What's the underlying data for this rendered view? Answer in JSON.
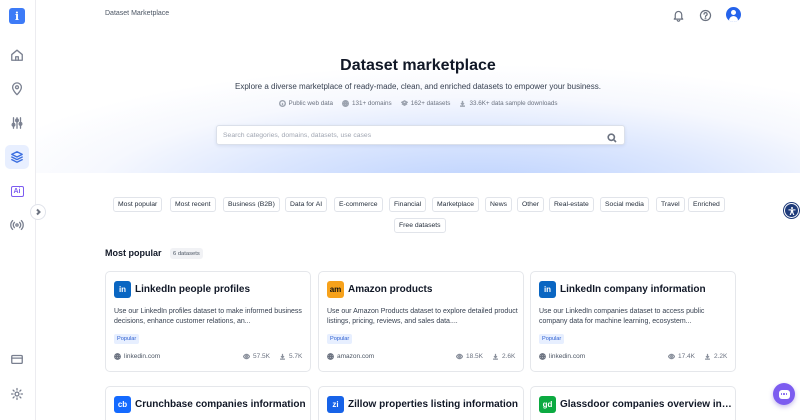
{
  "header": {
    "breadcrumb": "Dataset Marketplace",
    "icons": [
      "bell-icon",
      "help-icon",
      "user-avatar-icon"
    ]
  },
  "sidebar": {
    "logo": "i",
    "ai_label": "Ai",
    "items": [
      "home-icon",
      "location-pin-icon",
      "sliders-icon",
      "layers-icon",
      "ai-icon",
      "radar-icon",
      "billing-card-icon",
      "settings-gear-icon"
    ]
  },
  "hero": {
    "title": "Dataset marketplace",
    "subtitle": "Explore a diverse marketplace of ready-made, clean, and enriched datasets to empower your business.",
    "stats": [
      {
        "icon": "info-icon",
        "text": "Public web data"
      },
      {
        "icon": "globe-icon",
        "text": "131+ domains"
      },
      {
        "icon": "layers-icon",
        "text": "162+ datasets"
      },
      {
        "icon": "download-icon",
        "text": "33.6K+ data sample downloads"
      }
    ]
  },
  "search": {
    "placeholder": "Search categories, domains, datasets, use cases",
    "value": ""
  },
  "filters": [
    "Most popular",
    "Most recent",
    "Business (B2B)",
    "Data for AI",
    "E-commerce",
    "Financial",
    "Marketplace",
    "News",
    "Other",
    "Real-estate",
    "Social media",
    "Travel",
    "Enriched",
    "Free datasets"
  ],
  "section": {
    "title": "Most popular",
    "count": "6 datasets"
  },
  "cards": [
    {
      "logo": "in",
      "logo_color": "#0a66c2",
      "title": "LinkedIn people profiles",
      "desc": "Use our LinkedIn profiles dataset to make informed business decisions, enhance customer relations, an...",
      "tag": "Popular",
      "domain": "linkedin.com",
      "views": "57.5K",
      "downloads": "5.7K"
    },
    {
      "logo": "am",
      "logo_color": "#f7a21b",
      "title": "Amazon products",
      "desc": "Use our Amazon Products dataset to explore detailed product listings, pricing, reviews, and sales data....",
      "tag": "Popular",
      "domain": "amazon.com",
      "views": "18.5K",
      "downloads": "2.6K"
    },
    {
      "logo": "in",
      "logo_color": "#0a66c2",
      "title": "LinkedIn company information",
      "desc": "Use our LinkedIn companies dataset to access public company data for machine learning, ecosystem...",
      "tag": "Popular",
      "domain": "linkedin.com",
      "views": "17.4K",
      "downloads": "2.2K"
    },
    {
      "logo": "cb",
      "logo_color": "#146aff",
      "title": "Crunchbase companies information"
    },
    {
      "logo": "zi",
      "logo_color": "#1763e8",
      "title": "Zillow properties listing information"
    },
    {
      "logo": "gd",
      "logo_color": "#0caa41",
      "title": "Glassdoor companies overview information"
    }
  ]
}
